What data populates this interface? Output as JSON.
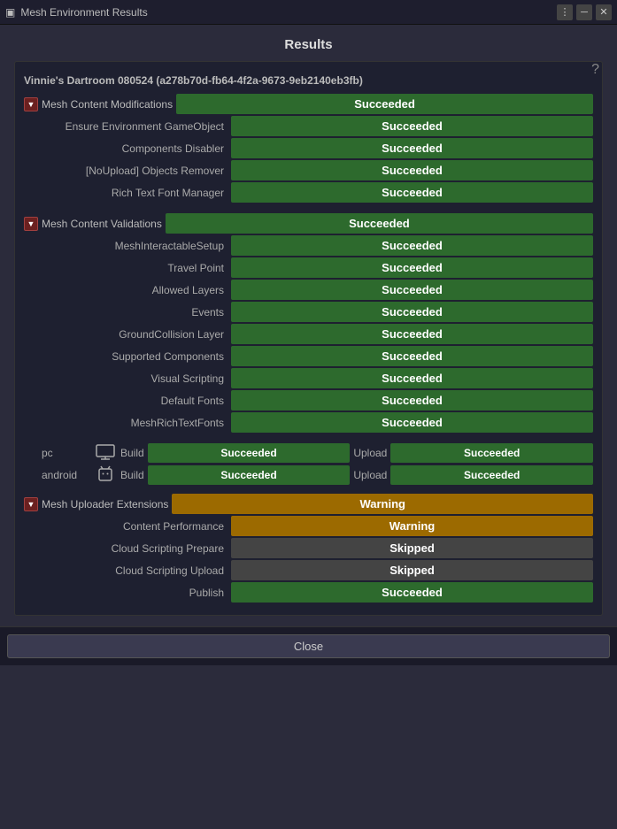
{
  "titleBar": {
    "title": "Mesh Environment Results",
    "menuIcon": "⋮",
    "minimizeIcon": "─",
    "closeIcon": "✕"
  },
  "window": {
    "title": "Results",
    "helpIcon": "?"
  },
  "panel": {
    "envTitle": "Vinnie's Dartroom 080524 (a278b70d-fb64-4f2a-9673-9eb2140eb3fb)"
  },
  "meshContentModifications": {
    "label": "Mesh Content Modifications",
    "status": "Succeeded",
    "rows": [
      {
        "label": "Ensure Environment GameObject",
        "status": "Succeeded"
      },
      {
        "label": "Components Disabler",
        "status": "Succeeded"
      },
      {
        "label": "[NoUpload] Objects Remover",
        "status": "Succeeded"
      },
      {
        "label": "Rich Text Font Manager",
        "status": "Succeeded"
      }
    ]
  },
  "meshContentValidations": {
    "label": "Mesh Content Validations",
    "status": "Succeeded",
    "rows": [
      {
        "label": "MeshInteractableSetup",
        "status": "Succeeded"
      },
      {
        "label": "Travel Point",
        "status": "Succeeded"
      },
      {
        "label": "Allowed Layers",
        "status": "Succeeded"
      },
      {
        "label": "Events",
        "status": "Succeeded"
      },
      {
        "label": "GroundCollision Layer",
        "status": "Succeeded"
      },
      {
        "label": "Supported Components",
        "status": "Succeeded"
      },
      {
        "label": "Visual Scripting",
        "status": "Succeeded"
      },
      {
        "label": "Default Fonts",
        "status": "Succeeded"
      },
      {
        "label": "MeshRichTextFonts",
        "status": "Succeeded"
      }
    ]
  },
  "platforms": [
    {
      "name": "pc",
      "icon": "🖥",
      "build": "Succeeded",
      "upload": "Succeeded"
    },
    {
      "name": "android",
      "icon": "📱",
      "build": "Succeeded",
      "upload": "Succeeded"
    }
  ],
  "meshUploaderExtensions": {
    "label": "Mesh Uploader Extensions",
    "status": "Warning",
    "rows": [
      {
        "label": "Content Performance",
        "status": "Warning",
        "type": "warning"
      },
      {
        "label": "Cloud Scripting Prepare",
        "status": "Skipped",
        "type": "skipped"
      },
      {
        "label": "Cloud Scripting Upload",
        "status": "Skipped",
        "type": "skipped"
      },
      {
        "label": "Publish",
        "status": "Succeeded",
        "type": "success"
      }
    ]
  },
  "closeButton": "Close",
  "buildLabel": "Build",
  "uploadLabel": "Upload"
}
